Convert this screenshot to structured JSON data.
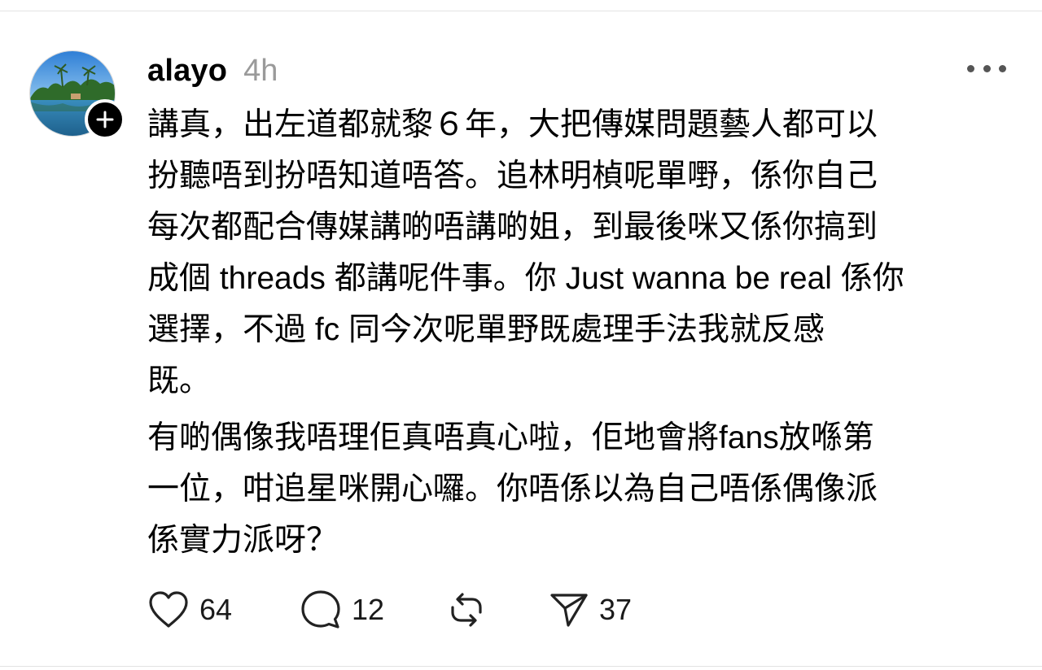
{
  "post": {
    "author": "alayo",
    "time": "4h",
    "paragraphs": [
      "講真，出左道都就黎６年，大把傳媒問題藝人都可以\n扮聽唔到扮唔知道唔答。追林明楨呢單嘢，係你自己\n每次都配合傳媒講啲唔講啲姐，到最後咪又係你搞到\n成個 threads 都講呢件事。你 Just wanna be real 係你\n選擇，不過 fc 同今次呢單野既處理手法我就反感\n既。",
      "有啲偶像我唔理佢真唔真心啦，佢地會將fans放喺第\n一位，咁追星咪開心囉。你唔係以為自己唔係偶像派\n係實力派呀？"
    ]
  },
  "actions": {
    "likes": "64",
    "replies": "12",
    "shares": "37"
  },
  "icons": {
    "more": "more-horizontal-icon",
    "follow": "plus-icon",
    "like": "heart-icon",
    "reply": "comment-bubble-icon",
    "repost": "repost-icon",
    "share": "send-icon"
  }
}
